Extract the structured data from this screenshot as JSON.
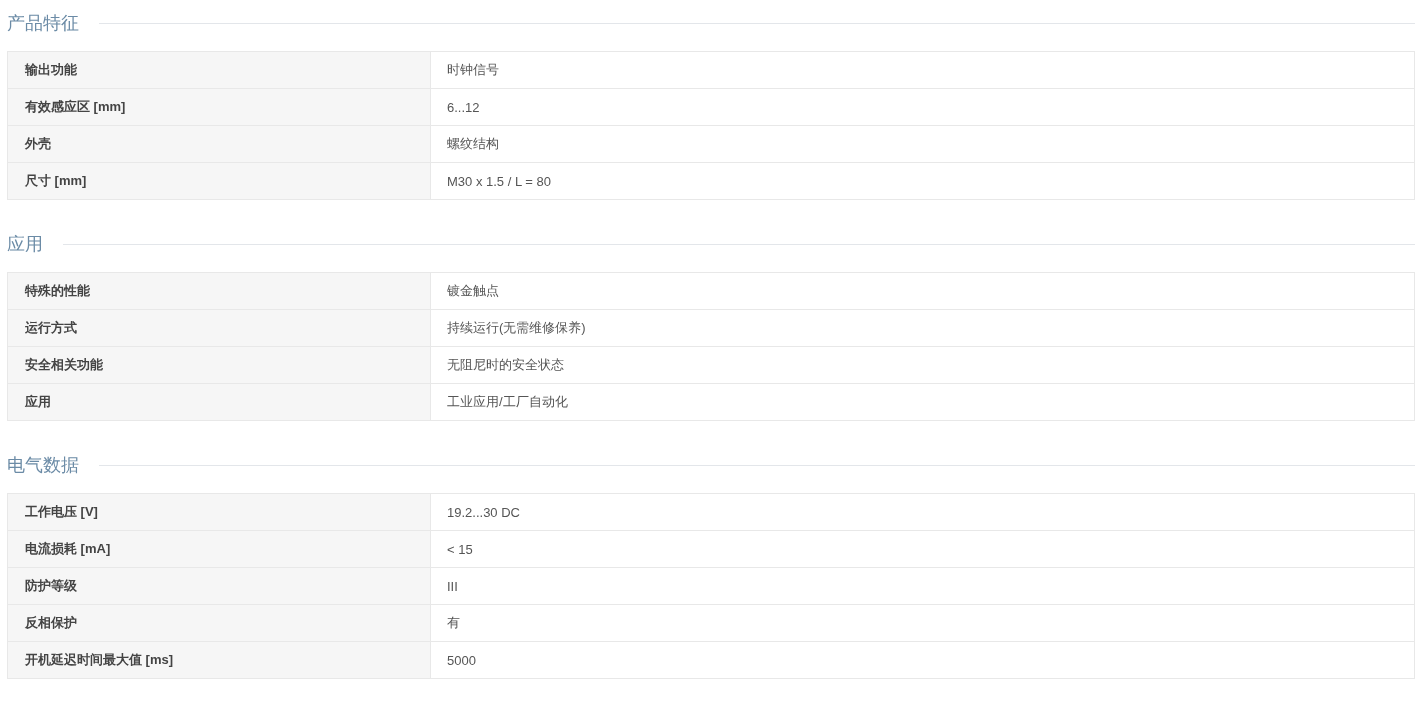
{
  "sections": [
    {
      "title": "产品特征",
      "rows": [
        {
          "label": "输出功能",
          "value": "时钟信号"
        },
        {
          "label": "有效感应区 [mm]",
          "value": "6...12"
        },
        {
          "label": "外壳",
          "value": "螺纹结构"
        },
        {
          "label": "尺寸 [mm]",
          "value": "M30 x 1.5 / L = 80"
        }
      ]
    },
    {
      "title": "应用",
      "rows": [
        {
          "label": "特殊的性能",
          "value": "镀金触点"
        },
        {
          "label": "运行方式",
          "value": "持续运行(无需维修保养)"
        },
        {
          "label": "安全相关功能",
          "value": "无阻尼时的安全状态"
        },
        {
          "label": "应用",
          "value": "工业应用/工厂自动化"
        }
      ]
    },
    {
      "title": "电气数据",
      "rows": [
        {
          "label": "工作电压 [V]",
          "value": "19.2...30 DC"
        },
        {
          "label": "电流损耗 [mA]",
          "value": "< 15"
        },
        {
          "label": "防护等级",
          "value": "III"
        },
        {
          "label": "反相保护",
          "value": "有"
        },
        {
          "label": "开机延迟时间最大值 [ms]",
          "value": "5000"
        }
      ]
    }
  ]
}
